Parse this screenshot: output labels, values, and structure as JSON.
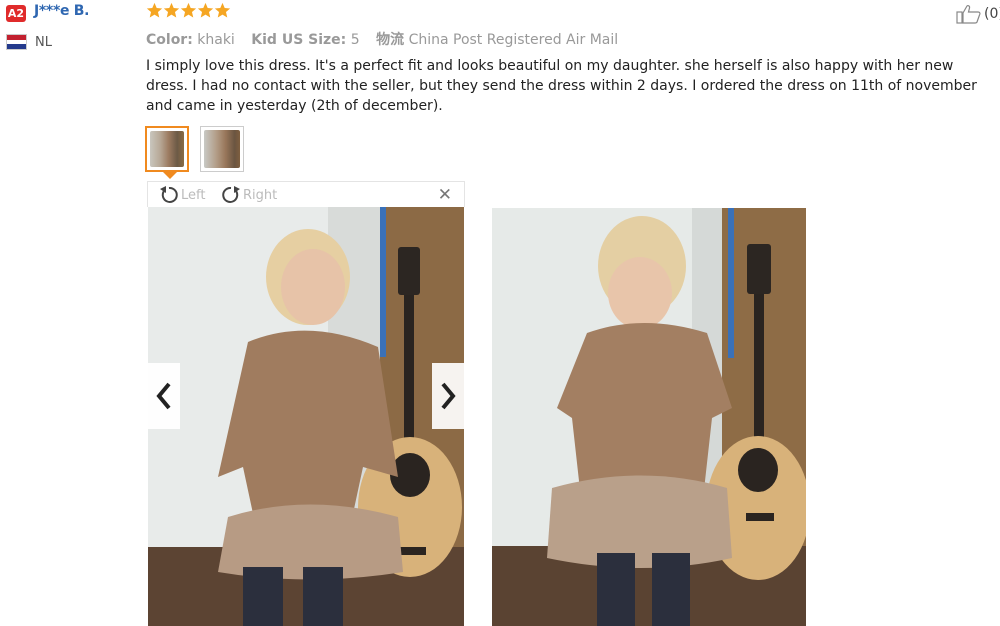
{
  "reviewer": {
    "level_badge": "A2",
    "name": "J***e B.",
    "country": "NL"
  },
  "rating": {
    "stars": 5,
    "max": 5,
    "color": "#f5a623"
  },
  "meta": {
    "color_label": "Color:",
    "color_value": "khaki",
    "size_label": "Kid US Size:",
    "size_value": "5",
    "shipping_label": "物流",
    "shipping_value": "China Post Registered Air Mail"
  },
  "review_text": "I simply love this dress. It's a perfect fit and looks beautiful on my daughter. she herself is also happy with her new dress. I had no contact with the seller, but they send the dress within 2 days. I ordered the dress on 11th of november and came in yesterday (2th of december).",
  "helpful": {
    "icon": "thumbs-up-icon",
    "count": "(0)"
  },
  "viewer": {
    "rotate_left_label": "Left",
    "rotate_right_label": "Right",
    "close_icon": "close-icon",
    "prev_icon": "chevron-left-icon",
    "next_icon": "chevron-right-icon"
  },
  "colors": {
    "accent": "#f08a1f",
    "name_link": "#2f67b1",
    "badge": "#e02b2b"
  }
}
